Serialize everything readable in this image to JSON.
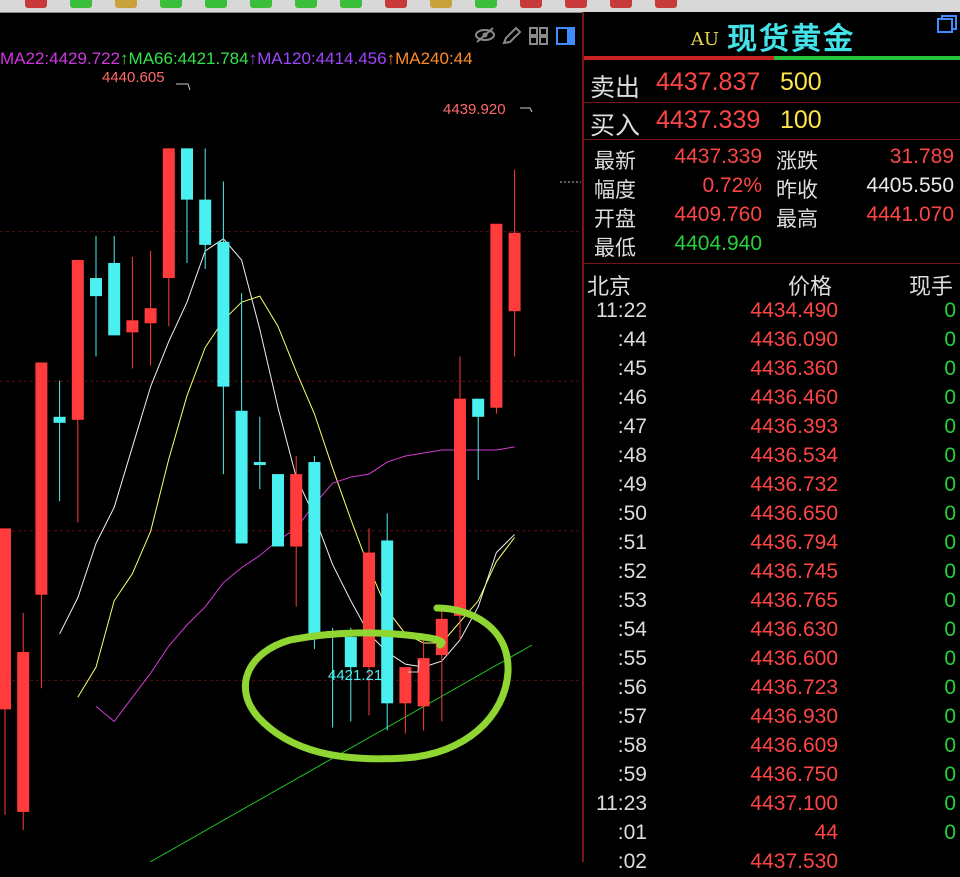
{
  "colors": {
    "up": "#ff3b3b",
    "down": "#4af0f0",
    "ma22": "#f0f0f0",
    "ma66": "#ffff6a",
    "ma120": "#d33bd3",
    "ma240": "#22c522",
    "annotation": "#8fd633",
    "panel_border": "#7a1515"
  },
  "chart": {
    "ma_legend": [
      {
        "text": "MA22:4429.722",
        "color": "#d036e0"
      },
      {
        "text": "↑MA66:4421.784",
        "color": "#31e24a"
      },
      {
        "text": "↑MA120:4414.456",
        "color": "#a045ff"
      },
      {
        "text": "↑MA240:44",
        "color": "#ff8a2a"
      }
    ],
    "high_label": "4440.605",
    "right_high_label": "4439.920",
    "low_label": "4421.218",
    "toolbar_icons": [
      "eye-icon",
      "pencil-icon",
      "grid-icon",
      "panel-icon"
    ]
  },
  "chart_data": {
    "type": "candlestick",
    "candles": [
      {
        "o": 4422.0,
        "h": 4428.0,
        "l": 4418.5,
        "c": 4428.0
      },
      {
        "o": 4418.6,
        "h": 4425.2,
        "l": 4418.0,
        "c": 4423.9
      },
      {
        "o": 4425.8,
        "h": 4432.6,
        "l": 4422.7,
        "c": 4433.5
      },
      {
        "o": 4431.7,
        "h": 4432.9,
        "l": 4428.9,
        "c": 4431.5
      },
      {
        "o": 4431.6,
        "h": 4436.8,
        "l": 4428.2,
        "c": 4436.9
      },
      {
        "o": 4436.3,
        "h": 4437.7,
        "l": 4433.7,
        "c": 4435.7
      },
      {
        "o": 4436.8,
        "h": 4437.7,
        "l": 4434.6,
        "c": 4434.4
      },
      {
        "o": 4434.5,
        "h": 4437.0,
        "l": 4433.3,
        "c": 4434.9
      },
      {
        "o": 4434.8,
        "h": 4437.2,
        "l": 4433.4,
        "c": 4435.3
      },
      {
        "o": 4436.3,
        "h": 4440.6,
        "l": 4434.7,
        "c": 4440.6
      },
      {
        "o": 4440.6,
        "h": 4440.6,
        "l": 4436.8,
        "c": 4438.9
      },
      {
        "o": 4438.9,
        "h": 4440.6,
        "l": 4436.6,
        "c": 4437.4
      },
      {
        "o": 4437.5,
        "h": 4439.5,
        "l": 4429.8,
        "c": 4432.7
      },
      {
        "o": 4431.9,
        "h": 4435.8,
        "l": 4431.0,
        "c": 4427.5
      },
      {
        "o": 4430.2,
        "h": 4431.7,
        "l": 4429.3,
        "c": 4430.1
      },
      {
        "o": 4429.8,
        "h": 4429.8,
        "l": 4427.8,
        "c": 4427.4
      },
      {
        "o": 4427.4,
        "h": 4430.4,
        "l": 4425.4,
        "c": 4429.8
      },
      {
        "o": 4430.2,
        "h": 4430.4,
        "l": 4424.0,
        "c": 4424.4
      },
      {
        "o": 4424.6,
        "h": 4424.7,
        "l": 4421.4,
        "c": 4424.4
      },
      {
        "o": 4424.4,
        "h": 4424.7,
        "l": 4421.6,
        "c": 4423.4
      },
      {
        "o": 4423.4,
        "h": 4428.0,
        "l": 4421.8,
        "c": 4427.2
      },
      {
        "o": 4427.6,
        "h": 4428.5,
        "l": 4421.3,
        "c": 4422.2
      },
      {
        "o": 4422.2,
        "h": 4423.3,
        "l": 4421.2,
        "c": 4423.4
      },
      {
        "o": 4422.1,
        "h": 4424.5,
        "l": 4421.3,
        "c": 4423.7
      },
      {
        "o": 4423.8,
        "h": 4425.4,
        "l": 4421.6,
        "c": 4425.0
      },
      {
        "o": 4425.1,
        "h": 4433.7,
        "l": 4424.3,
        "c": 4432.3
      },
      {
        "o": 4432.3,
        "h": 4432.3,
        "l": 4429.6,
        "c": 4431.7
      },
      {
        "o": 4432.0,
        "h": 4438.0,
        "l": 4431.8,
        "c": 4438.1
      },
      {
        "o": 4435.2,
        "h": 4439.9,
        "l": 4433.7,
        "c": 4437.8
      }
    ],
    "ylim": [
      4418.0,
      4442.8
    ],
    "ma_lines": [
      {
        "name": "MA22",
        "values": [
          4424.5,
          4425.7,
          4427.5,
          4428.7,
          4430.7,
          4432.7,
          4434.2,
          4435.5,
          4437.2,
          4437.6,
          4436.9,
          4434.6,
          4432.0,
          4429.7,
          4428.4,
          4426.8,
          4425.6,
          4424.5,
          4423.9,
          4423.5,
          4423.4,
          4423.6,
          4424.3,
          4425.4,
          4427.2,
          4427.8
        ]
      },
      {
        "name": "MA66",
        "values": [
          4422.4,
          4423.4,
          4425.6,
          4426.5,
          4427.9,
          4430.3,
          4432.4,
          4434.0,
          4434.9,
          4435.5,
          4435.7,
          4434.7,
          4433.2,
          4431.8,
          4430.0,
          4428.3,
          4426.7,
          4425.3,
          4424.5,
          4424.2,
          4424.2,
          4424.9,
          4425.6,
          4426.9,
          4427.7
        ]
      },
      {
        "name": "MA120",
        "values": [
          4422.1,
          4421.6,
          4422.4,
          4423.2,
          4424.1,
          4424.8,
          4425.4,
          4426.2,
          4426.7,
          4427.1,
          4427.6,
          4428.0,
          4428.8,
          4429.5,
          4429.7,
          4429.8,
          4430.2,
          4430.4,
          4430.5,
          4430.6,
          4430.6,
          4430.6,
          4430.6,
          4430.7
        ]
      }
    ]
  },
  "panel": {
    "title_prefix": "AU",
    "title": "现货黄金",
    "sell": {
      "label": "卖出",
      "price": "4437.837",
      "vol": "500"
    },
    "buy": {
      "label": "买入",
      "price": "4437.339",
      "vol": "100"
    },
    "stats": [
      {
        "label": "最新",
        "value": "4437.339",
        "color": "#ff4545"
      },
      {
        "label": "涨跌",
        "value": "31.789",
        "color": "#ff4545"
      },
      {
        "label": "幅度",
        "value": "0.72%",
        "color": "#ff4545"
      },
      {
        "label": "昨收",
        "value": "4405.550",
        "color": "#e8e8e8"
      },
      {
        "label": "开盘",
        "value": "4409.760",
        "color": "#ff4545"
      },
      {
        "label": "最高",
        "value": "4441.070",
        "color": "#ff4545"
      },
      {
        "label": "最低",
        "value": "4404.940",
        "color": "#27d13c"
      }
    ],
    "ticks_header": {
      "time": "北京",
      "price": "价格",
      "vol": "现手"
    },
    "ticks": [
      {
        "t": "11:22",
        "p": "4434.490",
        "v": "0"
      },
      {
        "t": ":44",
        "p": "4436.090",
        "v": "0"
      },
      {
        "t": ":45",
        "p": "4436.360",
        "v": "0"
      },
      {
        "t": ":46",
        "p": "4436.460",
        "v": "0"
      },
      {
        "t": ":47",
        "p": "4436.393",
        "v": "0"
      },
      {
        "t": ":48",
        "p": "4436.534",
        "v": "0"
      },
      {
        "t": ":49",
        "p": "4436.732",
        "v": "0"
      },
      {
        "t": ":50",
        "p": "4436.650",
        "v": "0"
      },
      {
        "t": ":51",
        "p": "4436.794",
        "v": "0"
      },
      {
        "t": ":52",
        "p": "4436.745",
        "v": "0"
      },
      {
        "t": ":53",
        "p": "4436.765",
        "v": "0"
      },
      {
        "t": ":54",
        "p": "4436.630",
        "v": "0"
      },
      {
        "t": ":55",
        "p": "4436.600",
        "v": "0"
      },
      {
        "t": ":56",
        "p": "4436.723",
        "v": "0"
      },
      {
        "t": ":57",
        "p": "4436.930",
        "v": "0"
      },
      {
        "t": ":58",
        "p": "4436.609",
        "v": "0"
      },
      {
        "t": ":59",
        "p": "4436.750",
        "v": "0"
      },
      {
        "t": "11:23",
        "p": "4437.100",
        "v": "0"
      },
      {
        "t": ":01",
        "p": "44",
        "v": "0"
      },
      {
        "t": ":02",
        "p": "4437.530",
        "v": ""
      }
    ]
  }
}
